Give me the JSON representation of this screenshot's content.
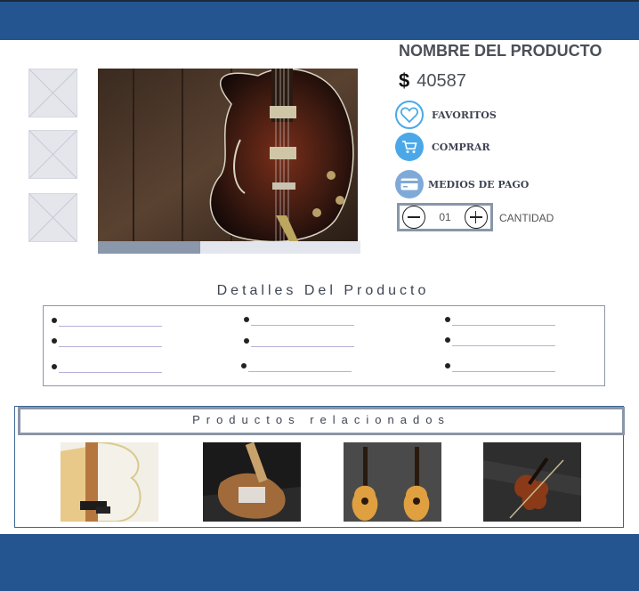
{
  "product": {
    "name": "NOMBRE DEL PRODUCTO",
    "currency_symbol": "$",
    "price": "40587",
    "image_progress": 0.39
  },
  "actions": {
    "favorites_label": "FAVORITOS",
    "buy_label": "COMPRAR",
    "payment_label": "MEDIOS DE PAGO"
  },
  "quantity": {
    "value": "01",
    "label": "CANTIDAD"
  },
  "details": {
    "title": "Detalles Del Producto"
  },
  "related": {
    "title": "Productos relacionados"
  },
  "colors": {
    "brand_blue": "#245590",
    "icon_blue": "#4aa8e8",
    "border_gray": "#8a96a8"
  },
  "icons": [
    "heart-icon",
    "shopping-cart-icon",
    "credit-card-icon",
    "minus-icon",
    "plus-icon",
    "image-placeholder-icon"
  ]
}
